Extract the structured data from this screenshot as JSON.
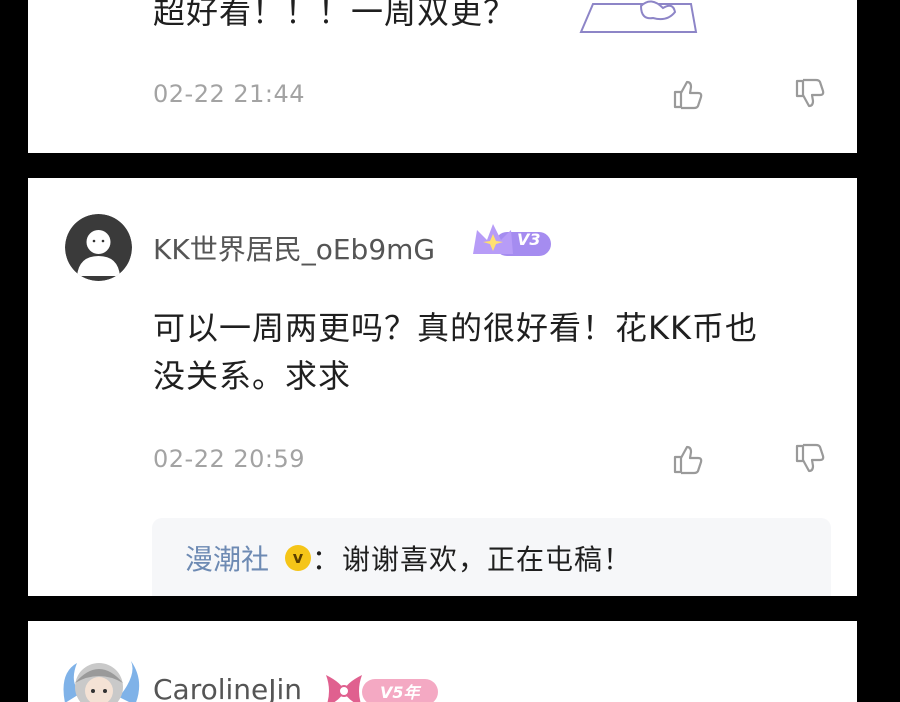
{
  "comments": [
    {
      "text": "超好看！！！一周双更？",
      "timestamp": "02-22 21:44",
      "like_icon": "thumbs-up-icon",
      "dislike_icon": "thumbs-down-icon"
    },
    {
      "username": "KK世界居民_oEb9mG",
      "level_badge": "V3",
      "text_line1": "可以一周两更吗？真的很好看！花KK币也",
      "text_line2": "没关系。求求",
      "timestamp": "02-22 20:59",
      "reply": {
        "author": "漫潮社",
        "verified_mark": "v",
        "separator": "：",
        "text": "谢谢喜欢，正在屯稿！"
      },
      "like_icon": "thumbs-up-icon",
      "dislike_icon": "thumbs-down-icon"
    },
    {
      "username": "CarolineJin",
      "level_badge": "V5年"
    }
  ],
  "colors": {
    "background": "#000000",
    "card": "#ffffff",
    "text": "#1f1f1f",
    "muted": "#a3a3a3",
    "reply_author": "#6d8ab3",
    "badge_purple": "#9b7be8",
    "badge_pink": "#e0608f"
  }
}
